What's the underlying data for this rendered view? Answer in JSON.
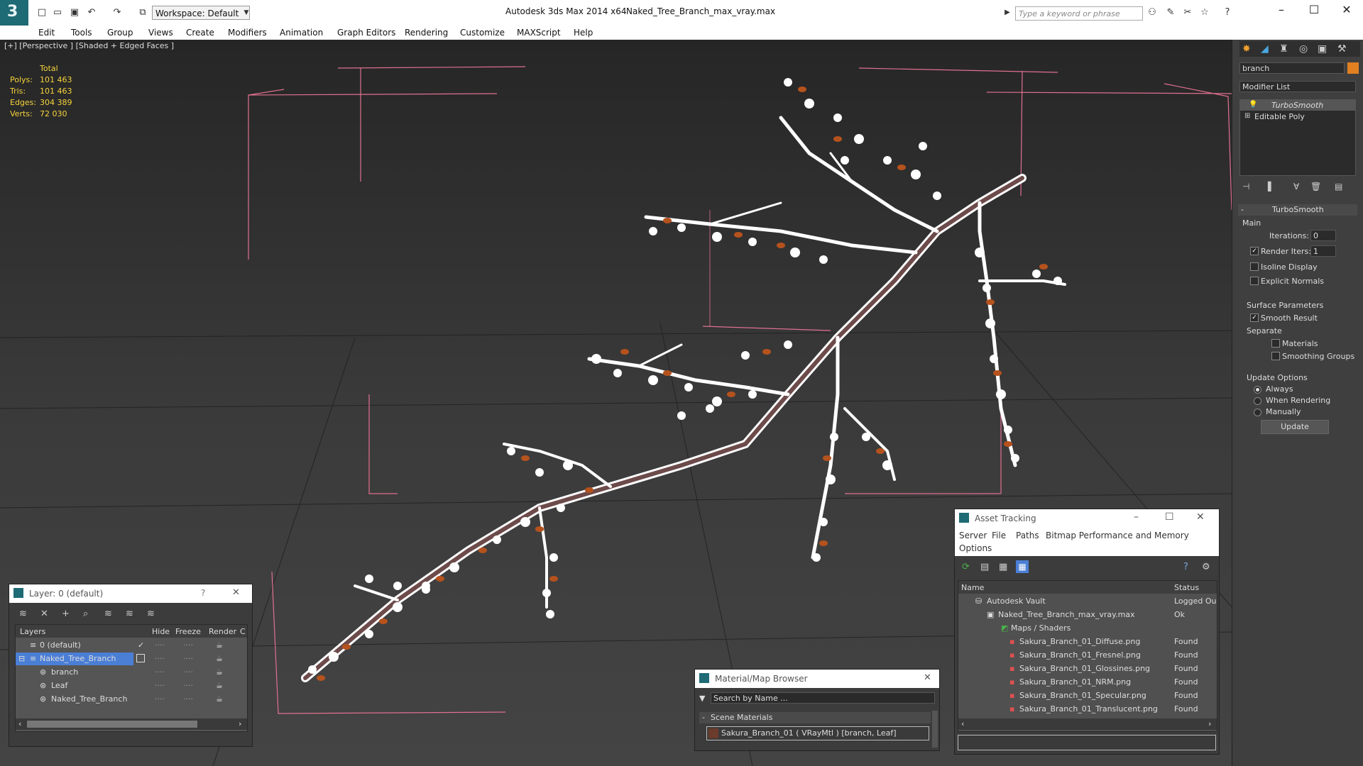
{
  "titlebar": {
    "workspace": "Workspace: Default",
    "app_title": "Autodesk 3ds Max  2014 x64",
    "file_title": "Naked_Tree_Branch_max_vray.max",
    "search_placeholder": "Type a keyword or phrase"
  },
  "menu": [
    "Edit",
    "Tools",
    "Group",
    "Views",
    "Create",
    "Modifiers",
    "Animation",
    "Graph Editors",
    "Rendering",
    "Customize",
    "MAXScript",
    "Help"
  ],
  "viewport": {
    "label": "[+] [Perspective ] [Shaded + Edged Faces ]",
    "stats_header": "Total",
    "stats": [
      {
        "label": "Polys:",
        "value": "101 463"
      },
      {
        "label": "Tris:",
        "value": "101 463"
      },
      {
        "label": "Edges:",
        "value": "304 389"
      },
      {
        "label": "Verts:",
        "value": "72 030"
      }
    ]
  },
  "command_panel": {
    "object_name": "branch",
    "modifier_list": "Modifier List",
    "stack": [
      "TurboSmooth",
      "Editable Poly"
    ],
    "rollout_title": "TurboSmooth",
    "main_label": "Main",
    "iterations_label": "Iterations:",
    "iterations_value": "0",
    "render_iters_label": "Render Iters:",
    "render_iters_value": "1",
    "isoline_label": "Isoline Display",
    "explicit_normals_label": "Explicit Normals",
    "surface_params_label": "Surface Parameters",
    "smooth_result_label": "Smooth Result",
    "separate_label": "Separate",
    "materials_label": "Materials",
    "smoothing_groups_label": "Smoothing Groups",
    "update_options_label": "Update Options",
    "always_label": "Always",
    "when_rendering_label": "When Rendering",
    "manually_label": "Manually",
    "update_button": "Update"
  },
  "layer_dialog": {
    "title": "Layer: 0 (default)",
    "help": "?",
    "columns": [
      "Layers",
      "Hide",
      "Freeze",
      "Render",
      "C"
    ],
    "rows": [
      "0 (default)",
      "Naked_Tree_Branch",
      "branch",
      "Leaf",
      "Naked_Tree_Branch"
    ]
  },
  "material_browser": {
    "title": "Material/Map Browser",
    "search_placeholder": "Search by Name ...",
    "section": "Scene Materials",
    "item": "Sakura_Branch_01  ( VRayMtl )  [branch, Leaf]"
  },
  "asset_tracking": {
    "title": "Asset Tracking",
    "menu": [
      "Server",
      "File",
      "Paths",
      "Bitmap Performance and Memory",
      "Options"
    ],
    "columns": [
      "Name",
      "Status"
    ],
    "rows": [
      {
        "name": "Autodesk Vault",
        "status": "Logged Ou"
      },
      {
        "name": "Naked_Tree_Branch_max_vray.max",
        "status": "Ok"
      },
      {
        "name": "Maps / Shaders",
        "status": ""
      },
      {
        "name": "Sakura_Branch_01_Diffuse.png",
        "status": "Found"
      },
      {
        "name": "Sakura_Branch_01_Fresnel.png",
        "status": "Found"
      },
      {
        "name": "Sakura_Branch_01_Glossines.png",
        "status": "Found"
      },
      {
        "name": "Sakura_Branch_01_NRM.png",
        "status": "Found"
      },
      {
        "name": "Sakura_Branch_01_Specular.png",
        "status": "Found"
      },
      {
        "name": "Sakura_Branch_01_Translucent.png",
        "status": "Found"
      }
    ]
  },
  "colors": {
    "accent_blue": "#4b7fd6",
    "stats_yellow": "#f6d33c",
    "bbox_pink": "#e07090",
    "leaf_orange": "#b5521d"
  }
}
